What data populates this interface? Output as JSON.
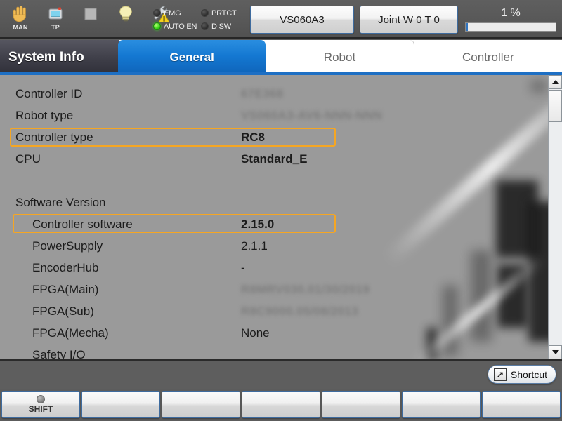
{
  "toolbar": {
    "icons": [
      {
        "name": "hand-icon",
        "caption": "MAN"
      },
      {
        "name": "teach-pendant-icon",
        "caption": "TP"
      },
      {
        "name": "stop-square-icon",
        "caption": ""
      },
      {
        "name": "lamp-icon",
        "caption": ""
      },
      {
        "name": "wrench-warning-icon",
        "caption": ""
      }
    ],
    "leds": [
      {
        "label": "EMG",
        "on": false
      },
      {
        "label": "PRTCT",
        "on": false
      },
      {
        "label": "AUTO EN",
        "on": true
      },
      {
        "label": "D SW",
        "on": false
      }
    ],
    "model_button": "VS060A3",
    "coord_button": "Joint  W 0 T 0",
    "speed_value": "1 %",
    "speed_percent": 1
  },
  "header": {
    "title": "System Info",
    "tabs": [
      {
        "label": "General",
        "active": true
      },
      {
        "label": "Robot",
        "active": false
      },
      {
        "label": "Controller",
        "active": false
      }
    ]
  },
  "main": {
    "rows": [
      {
        "label": "Controller ID",
        "value": "67E368",
        "indent": false,
        "blurred": true,
        "bold": false,
        "highlighted": false
      },
      {
        "label": "Robot type",
        "value": "VS060A3-AV6-NNN-NNN",
        "indent": false,
        "blurred": true,
        "bold": false,
        "highlighted": false
      },
      {
        "label": "Controller type",
        "value": "RC8",
        "indent": false,
        "blurred": false,
        "bold": true,
        "highlighted": true
      },
      {
        "label": "CPU",
        "value": "Standard_E",
        "indent": false,
        "blurred": false,
        "bold": true,
        "highlighted": false
      },
      {
        "label": "",
        "value": "",
        "indent": false,
        "blurred": false,
        "bold": false,
        "highlighted": false
      },
      {
        "label": "Software Version",
        "value": "",
        "indent": false,
        "blurred": false,
        "bold": false,
        "highlighted": false
      },
      {
        "label": "Controller software",
        "value": "2.15.0",
        "indent": true,
        "blurred": false,
        "bold": true,
        "highlighted": true
      },
      {
        "label": "PowerSupply",
        "value": "2.1.1",
        "indent": true,
        "blurred": false,
        "bold": false,
        "highlighted": false
      },
      {
        "label": "EncoderHub",
        "value": "-",
        "indent": true,
        "blurred": false,
        "bold": false,
        "highlighted": false
      },
      {
        "label": "FPGA(Main)",
        "value": "R8MRV030.01/30/2019",
        "indent": true,
        "blurred": true,
        "bold": false,
        "highlighted": false
      },
      {
        "label": "FPGA(Sub)",
        "value": "R8C9000.05/08/2013",
        "indent": true,
        "blurred": true,
        "bold": false,
        "highlighted": false
      },
      {
        "label": "FPGA(Mecha)",
        "value": "None",
        "indent": true,
        "blurred": false,
        "bold": false,
        "highlighted": false
      },
      {
        "label": "Safety I/O",
        "value": "",
        "indent": true,
        "blurred": false,
        "bold": false,
        "highlighted": false
      }
    ],
    "scroll": {
      "up_icon": "chevron-up-icon",
      "down_icon": "chevron-down-icon"
    }
  },
  "statusbar": {
    "shortcut_label": "Shortcut",
    "shortcut_icon": "shortcut-arrow-icon"
  },
  "function_keys": [
    {
      "label": "SHIFT",
      "has_dot": true
    },
    {
      "label": "",
      "has_dot": false
    },
    {
      "label": "",
      "has_dot": false
    },
    {
      "label": "",
      "has_dot": false
    },
    {
      "label": "",
      "has_dot": false
    },
    {
      "label": "",
      "has_dot": false
    },
    {
      "label": "",
      "has_dot": false
    }
  ],
  "colors": {
    "accent_blue": "#1478d2",
    "highlight_orange": "#f5a623",
    "toolbar_gray": "#5c5c5c",
    "content_gray": "#9a9a9a",
    "led_green": "#35d413"
  }
}
